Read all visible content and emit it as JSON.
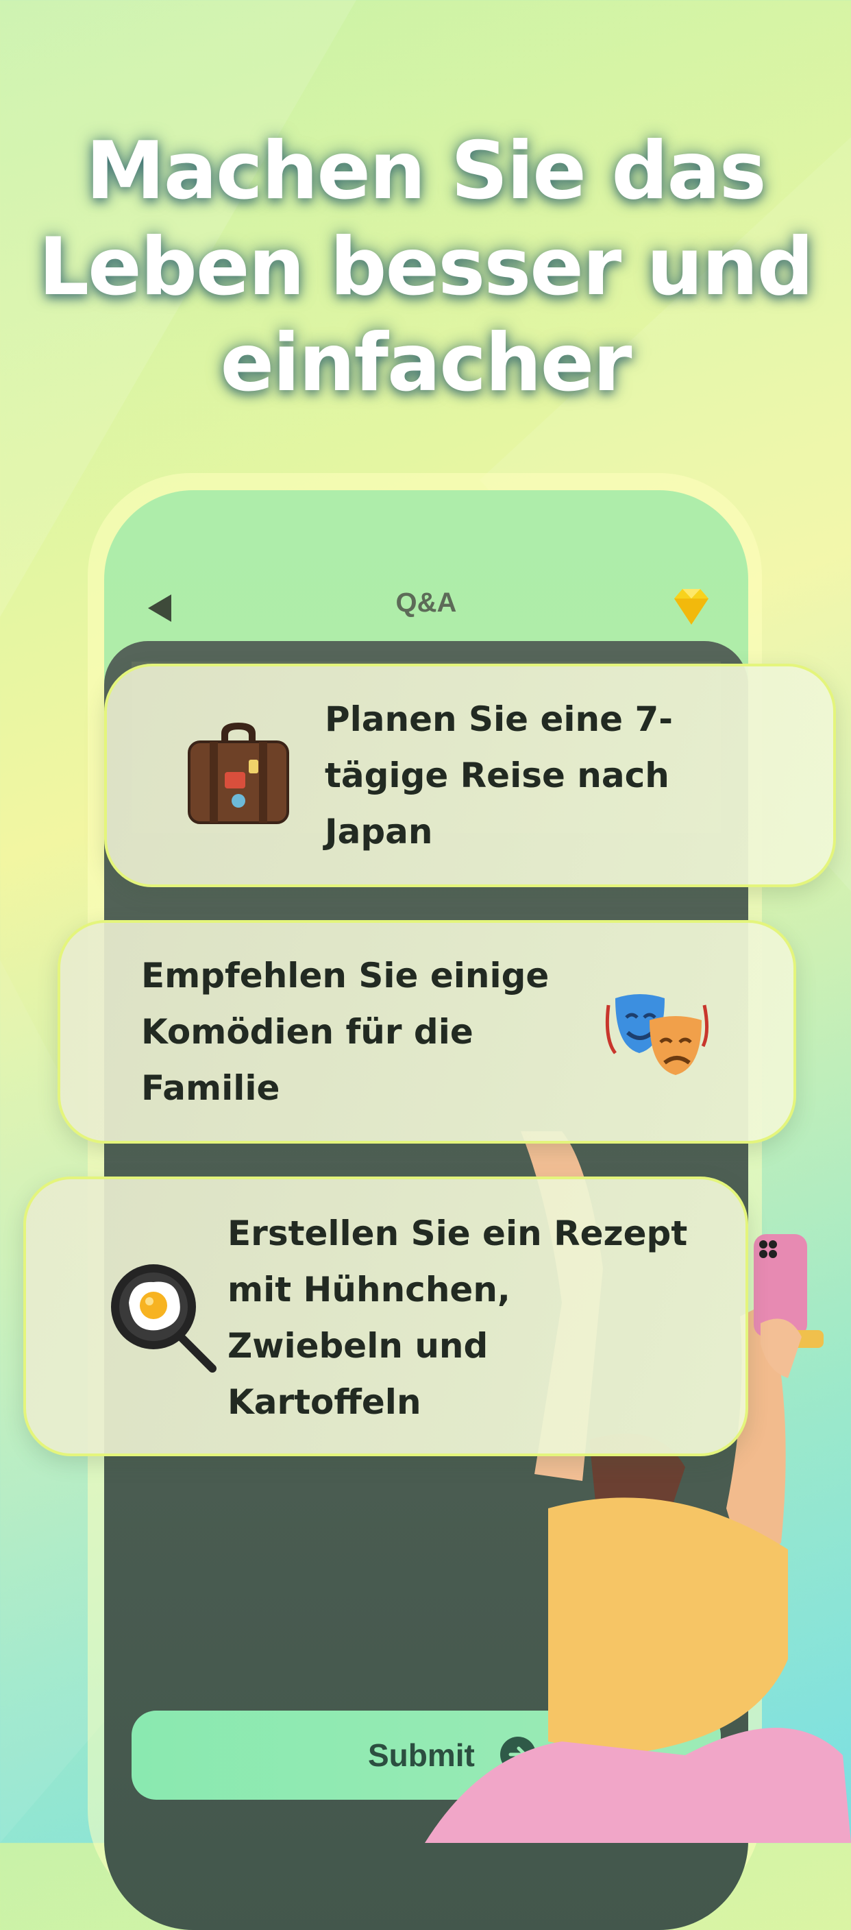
{
  "headline": {
    "lines": [
      "Machen Sie das",
      "Leben besser und",
      "einfacher"
    ]
  },
  "phone": {
    "header": {
      "title": "Q&A",
      "back_icon": "back-arrow-icon",
      "premium_icon": "diamond-icon"
    },
    "submit_label": "Submit",
    "submit_icon": "arrow-right-circle-icon"
  },
  "prompts": [
    {
      "lines": [
        "Planen Sie eine 7-",
        "tägige Reise nach",
        "Japan"
      ],
      "icon": "suitcase-icon"
    },
    {
      "lines": [
        "Empfehlen Sie einige",
        "Komödien für die",
        "Familie"
      ],
      "icon": "theater-masks-icon"
    },
    {
      "lines": [
        "Erstellen Sie ein Rezept",
        "mit Hühnchen,",
        "Zwiebeln und",
        "Kartoffeln"
      ],
      "icon": "fried-egg-pan-icon"
    }
  ],
  "colors": {
    "accent_yellow": "#e4f57c",
    "phone_green": "#aeedaa",
    "panel_dark": "#4c5e52",
    "submit_green": "#8ae9b0"
  }
}
